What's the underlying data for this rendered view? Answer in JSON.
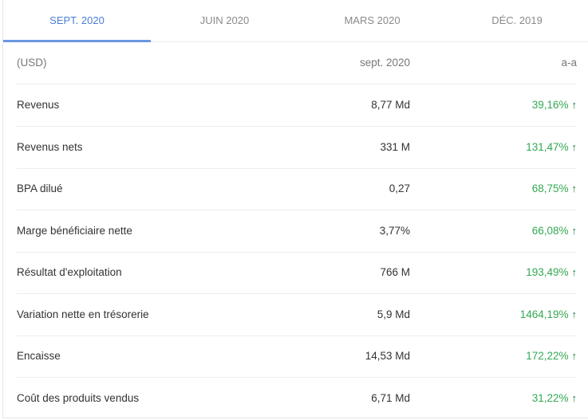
{
  "tabs": [
    {
      "label": "SEPT. 2020",
      "active": true
    },
    {
      "label": "JUIN 2020",
      "active": false
    },
    {
      "label": "MARS 2020",
      "active": false
    },
    {
      "label": "DÉC. 2019",
      "active": false
    }
  ],
  "table": {
    "header": {
      "currency": "(USD)",
      "period": "sept. 2020",
      "change": "a-a"
    },
    "rows": [
      {
        "label": "Revenus",
        "value": "8,77 Md",
        "change": "39,16%"
      },
      {
        "label": "Revenus nets",
        "value": "331 M",
        "change": "131,47%"
      },
      {
        "label": "BPA dilué",
        "value": "0,27",
        "change": "68,75%"
      },
      {
        "label": "Marge bénéficiaire nette",
        "value": "3,77%",
        "change": "66,08%"
      },
      {
        "label": "Résultat d'exploitation",
        "value": "766 M",
        "change": "193,49%"
      },
      {
        "label": "Variation nette en trésorerie",
        "value": "5,9 Md",
        "change": "1464,19%"
      },
      {
        "label": "Encaisse",
        "value": "14,53 Md",
        "change": "172,22%"
      },
      {
        "label": "Coût des produits vendus",
        "value": "6,71 Md",
        "change": "31,22%"
      }
    ]
  },
  "icons": {
    "trend": "arrow-up-icon"
  },
  "colors": {
    "accent": "#4a7fd6",
    "positive": "#34a853"
  }
}
